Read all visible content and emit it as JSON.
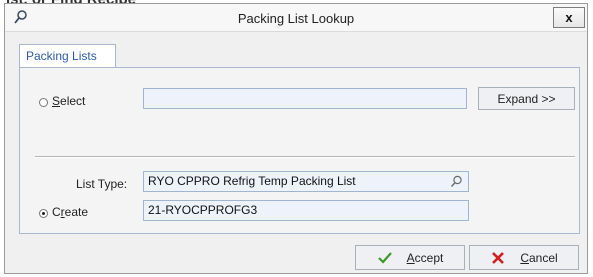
{
  "window": {
    "background_fragment": "lst, or Find Recipe",
    "title": "Packing List Lookup",
    "close_label": "x",
    "title_icon": "search-icon"
  },
  "tabs": [
    {
      "label": "Packing Lists",
      "active": true
    }
  ],
  "select": {
    "label_underlined": "S",
    "label_rest": "elect",
    "checked": false,
    "value": "",
    "expand_label": "Expand >>"
  },
  "list_type": {
    "label": "List Type:",
    "value": "RYO CPPRO Refrig Temp Packing List",
    "icon": "search-icon"
  },
  "create": {
    "label_prefix": "C",
    "label_underlined": "r",
    "label_rest": "eate",
    "checked": true,
    "value": "21-RYOCPPROFG3"
  },
  "footer": {
    "accept_underlined": "A",
    "accept_rest": "ccept",
    "cancel_underlined": "C",
    "cancel_rest": "ancel"
  },
  "colors": {
    "accept_icon": "#3a9a2a",
    "cancel_icon": "#d32020",
    "tab_text": "#2a5bb0"
  }
}
